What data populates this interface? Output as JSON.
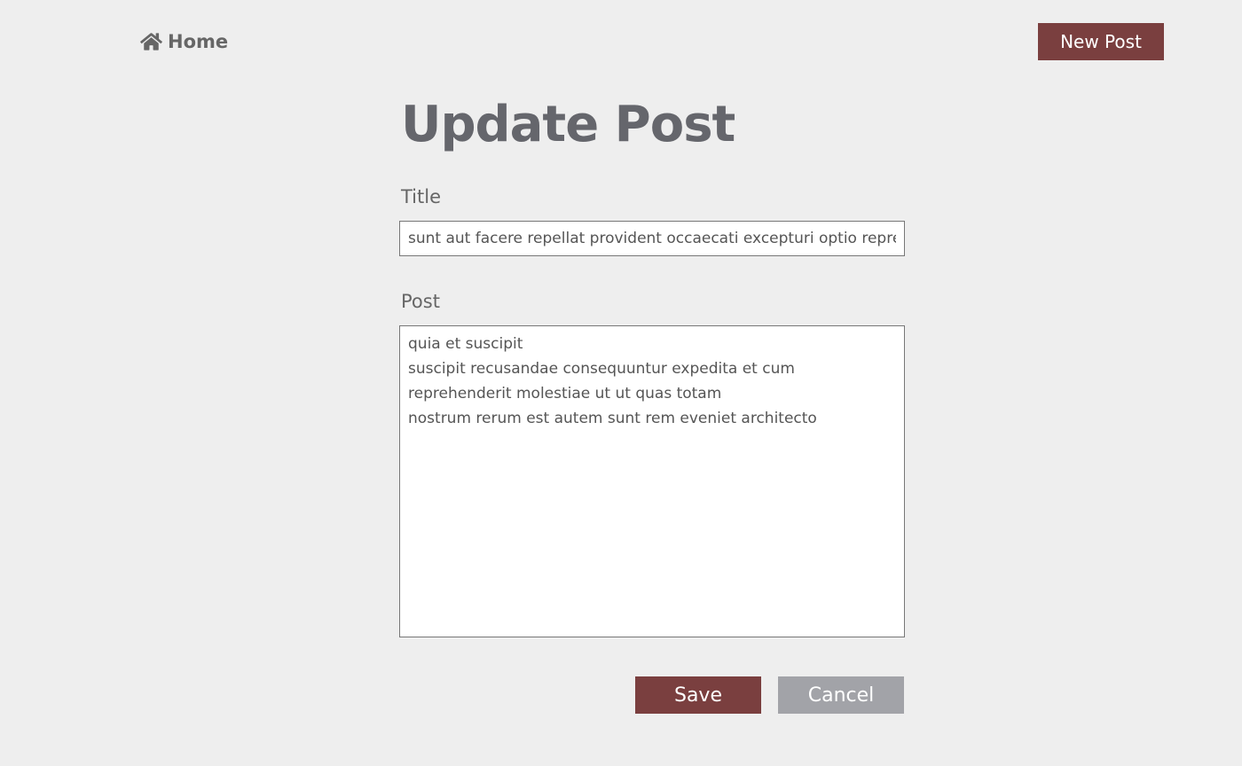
{
  "nav": {
    "home_label": "Home",
    "new_post_label": "New Post"
  },
  "form": {
    "heading": "Update Post",
    "title_label": "Title",
    "title_value": "sunt aut facere repellat provident occaecati excepturi optio reprehenderit",
    "post_label": "Post",
    "post_value": "quia et suscipit\nsuscipit recusandae consequuntur expedita et cum\nreprehenderit molestiae ut ut quas totam\nnostrum rerum est autem sunt rem eveniet architecto",
    "save_label": "Save",
    "cancel_label": "Cancel"
  },
  "icons": {
    "home": "home-icon"
  },
  "colors": {
    "background": "#eeeeee",
    "primary_button": "#7a3f3f",
    "secondary_button": "#a2a3a8",
    "heading_text": "#65666c"
  }
}
